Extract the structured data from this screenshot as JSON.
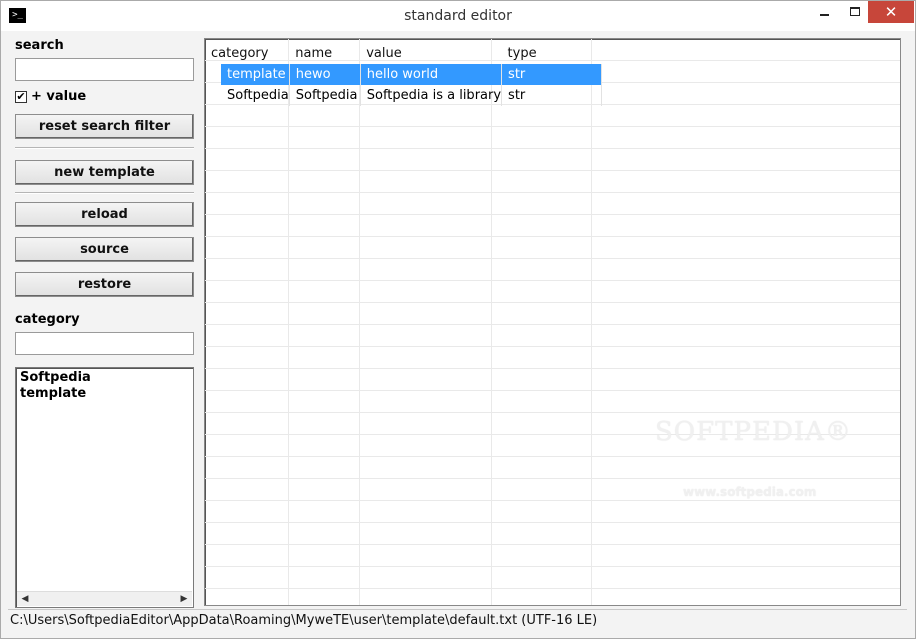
{
  "window": {
    "title": "standard editor",
    "app_icon_glyph": ">_",
    "close_glyph": "✕"
  },
  "left": {
    "search_label": "search",
    "search_value": "",
    "value_checkbox_label": "+ value",
    "value_checkbox_checked": "✔",
    "reset_button": "reset search filter",
    "new_template_button": "new template",
    "reload_button": "reload",
    "source_button": "source",
    "restore_button": "restore",
    "category_label": "category",
    "category_value": "",
    "category_list": [
      "Softpedia",
      "template"
    ],
    "scroll_left": "◀",
    "scroll_right": "▶"
  },
  "grid": {
    "columns": [
      "category",
      "name",
      "value",
      "type"
    ],
    "rows": [
      {
        "category": "template",
        "name": "hewo",
        "value": "hello world",
        "type": "str",
        "selected": true
      },
      {
        "category": "Softpedia",
        "name": "Softpedia",
        "value": "Softpedia is a library",
        "type": "str",
        "selected": false
      }
    ]
  },
  "watermark": {
    "logo": "SOFTPEDIA®",
    "url": "www.softpedia.com"
  },
  "status": {
    "path": "C:\\Users\\SoftpediaEditor\\AppData\\Roaming\\MyweTE\\user\\template\\default.txt (UTF-16 LE)"
  },
  "colors": {
    "selection": "#3399ff",
    "close_button": "#c7463a"
  }
}
